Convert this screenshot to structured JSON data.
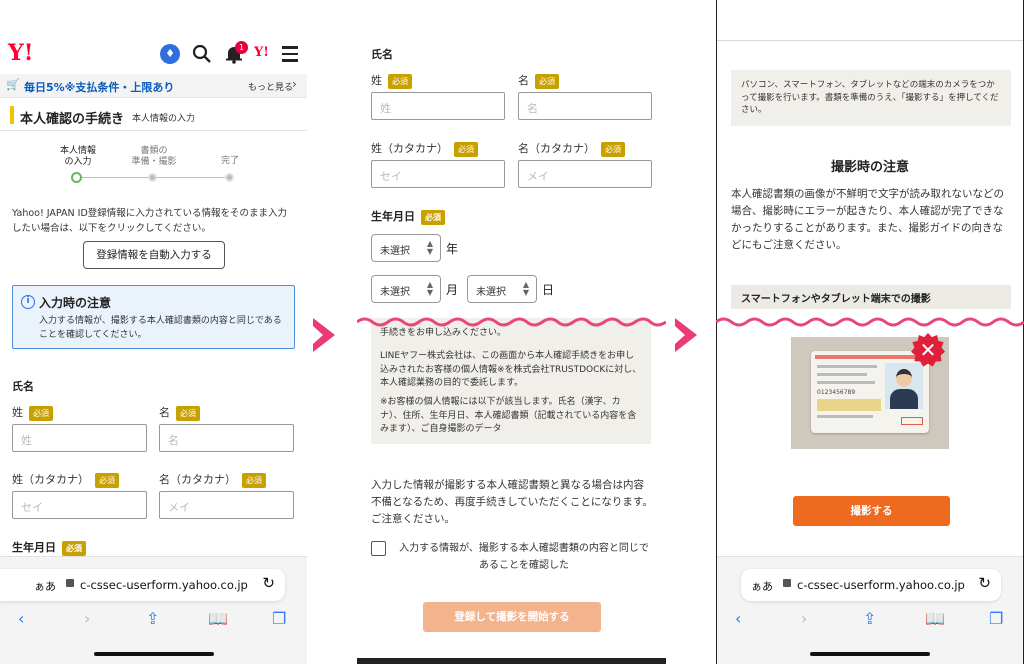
{
  "p1": {
    "logo": "Y!",
    "badge_count": "1",
    "promo": {
      "text": "毎日5%※支払条件・上限あり",
      "more": "もっと見る"
    },
    "title": "本人確認の手続き",
    "subtitle": "本人情報の入力",
    "steps": [
      "本人情報\nの入力",
      "書類の\n準備・撮影",
      "完了"
    ],
    "intro": "Yahoo! JAPAN ID登録情報に入力されている情報をそのまま入力したい場合は、以下をクリックしてください。",
    "autofill": "登録情報を自動入力する",
    "notice": {
      "title": "入力時の注意",
      "body": "入力する情報が、撮影する本人確認書類の内容と同じであることを確認してください。"
    },
    "name_heading": "氏名",
    "last_label": "姓",
    "first_label": "名",
    "required": "必須",
    "last_ph": "姓",
    "first_ph": "名",
    "last_kana_label": "姓（カタカナ）",
    "first_kana_label": "名（カタカナ）",
    "last_kana_ph": "セイ",
    "first_kana_ph": "メイ",
    "birth_heading": "生年月日"
  },
  "p2": {
    "name_heading": "氏名",
    "last_label": "姓",
    "first_label": "名",
    "required": "必須",
    "last_ph": "姓",
    "first_ph": "名",
    "last_kana_label": "姓（カタカナ）",
    "first_kana_label": "名（カタカナ）",
    "last_kana_ph": "セイ",
    "first_kana_ph": "メイ",
    "birth_heading": "生年月日",
    "unselected": "未選択",
    "year": "年",
    "month": "月",
    "day": "日",
    "info_top": "手続きをお申し込みください。",
    "info_p1": "LINEヤフー株式会社は、この画面から本人確認手続きをお申し込みされたお客様の個人情報※を株式会社TRUSTDOCKに対し、本人確認業務の目的で委託します。",
    "info_p2": "※お客様の個人情報には以下が該当します。氏名（漢字、カナ）、住所、生年月日、本人確認書類（記載されている内容を含みます）、ご自身撮影のデータ",
    "warning": "入力した情報が撮影する本人確認書類と異なる場合は内容不備となるため、再度手続きしていただくことになります。ご注意ください。",
    "confirm": "入力する情報が、撮影する本人確認書類の内容と同じであることを確認した",
    "submit": "登録して撮影を開始する"
  },
  "p3": {
    "intro": "パソコン、スマートフォン、タブレットなどの端末のカメラをつかって撮影を行います。書類を準備のうえ、「撮影する」を押してください。",
    "caution_title": "撮影時の注意",
    "caution_body": "本人確認書類の画像が不鮮明で文字が読み取れないなどの場合、撮影時にエラーが起きたり、本人確認が完了できなかったりすることがあります。また、撮影ガイドの向きなどにもご注意ください。",
    "section": "スマートフォンやタブレット端末での撮影",
    "card_number": "0123456789",
    "shoot": "撮影する"
  },
  "safari": {
    "aa": "ぁあ",
    "url": "c-cssec-userform.yahoo.co.jp"
  },
  "colors": {
    "accent": "#ee6a1f",
    "required": "#c8a100",
    "arrow": "#ea3b72",
    "wave": "#e8467a",
    "notice_border": "#4a90d9"
  }
}
